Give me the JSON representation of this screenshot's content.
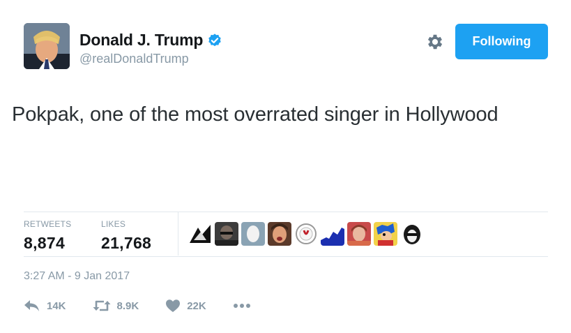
{
  "header": {
    "display_name": "Donald J. Trump",
    "handle": "@realDonaldTrump",
    "follow_button_label": "Following",
    "icons": [
      "verified-badge-icon",
      "gear-icon"
    ]
  },
  "tweet": {
    "text": "Pokpak, one of the most overrated singer in Hollywood",
    "timestamp": "3:27 AM - 9 Jan 2017"
  },
  "stats": {
    "retweets_label": "RETWEETS",
    "retweets_value": "8,874",
    "likes_label": "LIKES",
    "likes_value": "21,768"
  },
  "actions": {
    "reply_count": "14K",
    "retweet_count": "8.9K",
    "like_count": "22K",
    "icons": [
      "reply-icon",
      "retweet-icon",
      "heart-icon",
      "more-icon"
    ]
  },
  "colors": {
    "accent": "#1da1f2",
    "muted_text": "#8899a6",
    "primary_text": "#14171a",
    "divider": "#e1e8ed"
  }
}
